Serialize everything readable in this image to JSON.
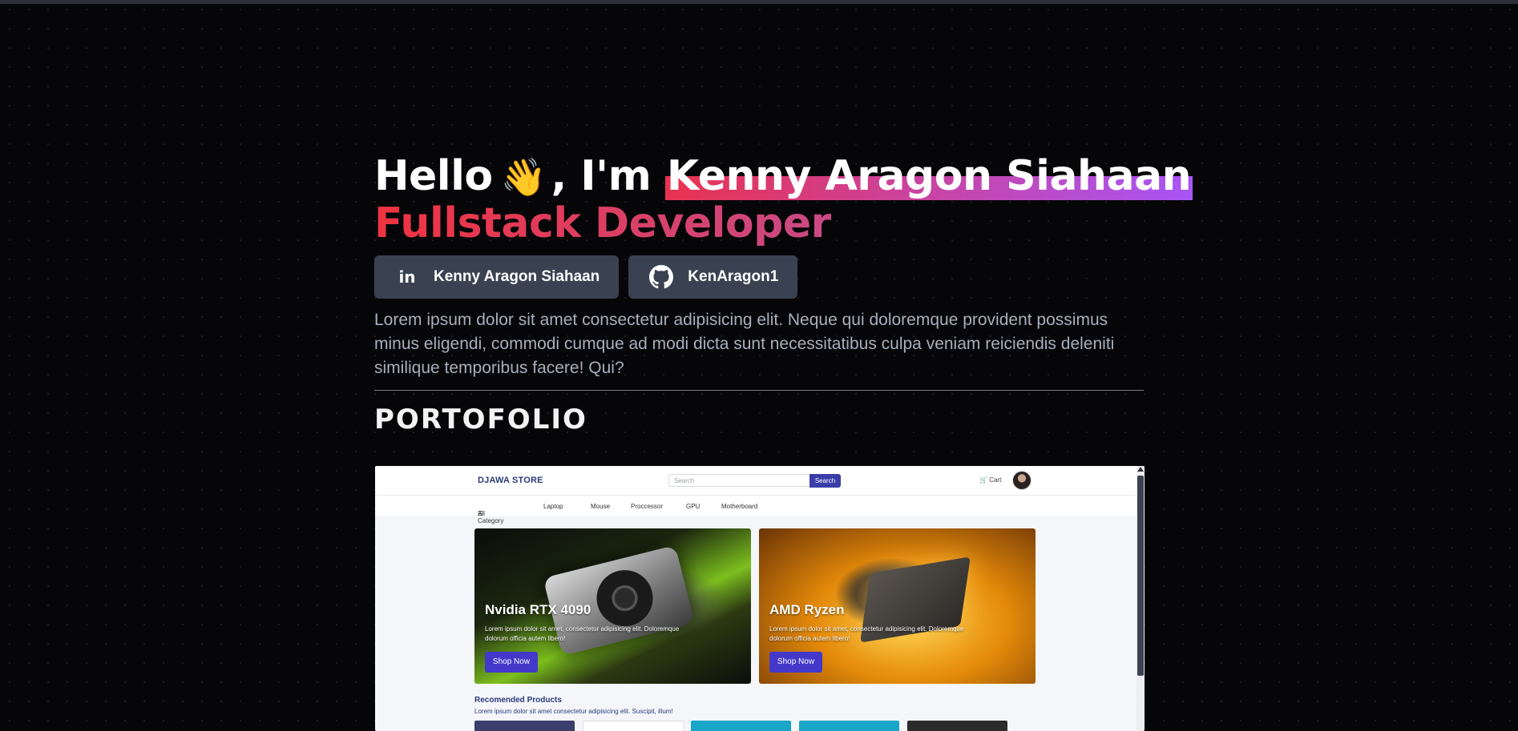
{
  "hero": {
    "greeting": "Hello",
    "wave_emoji": "👋",
    "intro": ", I'm",
    "name": "Kenny Aragon Siahaan",
    "role": "Fullstack Developer",
    "description": "Lorem ipsum dolor sit amet consectetur adipisicing elit. Neque qui doloremque provident possimus minus eligendi, commodi cumque ad modi dicta sunt necessitatibus culpa veniam reiciendis deleniti similique temporibus facere! Qui?"
  },
  "socials": [
    {
      "icon": "linkedin-icon",
      "glyph": "in",
      "label": "Kenny Aragon Siahaan"
    },
    {
      "icon": "github-icon",
      "label": "KenAragon1"
    }
  ],
  "section_title": "PORTOFOLIO",
  "store": {
    "brand": "DJAWA STORE",
    "search_placeholder": "Search",
    "search_button": "Search",
    "cart_label": "Cart",
    "categories": [
      "All Category",
      "Laptop",
      "Mouse",
      "Proccessor",
      "GPU",
      "Motherboard"
    ],
    "cards": [
      {
        "title": "Nvidia RTX 4090",
        "text": "Lorem ipsum dolor sit amet, consectetur adipisicing elit. Doloremque dolorum officia autem libero!",
        "button": "Shop Now"
      },
      {
        "title": "AMD Ryzen",
        "text": "Lorem ipsum dolor sit amet, consectetur adipisicing elit. Doloremque dolorum officia autem libero!",
        "button": "Shop Now"
      }
    ],
    "recommended_title": "Recomended Products",
    "recommended_sub": "Lorem ipsum dolor sit amet consectetur adipisicing elit. Suscipit, illum!"
  },
  "colors": {
    "background": "#060608",
    "name_highlight_start": "#e8334f",
    "name_highlight_end": "#a855f7",
    "role_start": "#ef3340",
    "role_end": "#c94a86",
    "social_button": "#3a4251",
    "store_accent": "#4338ca"
  }
}
